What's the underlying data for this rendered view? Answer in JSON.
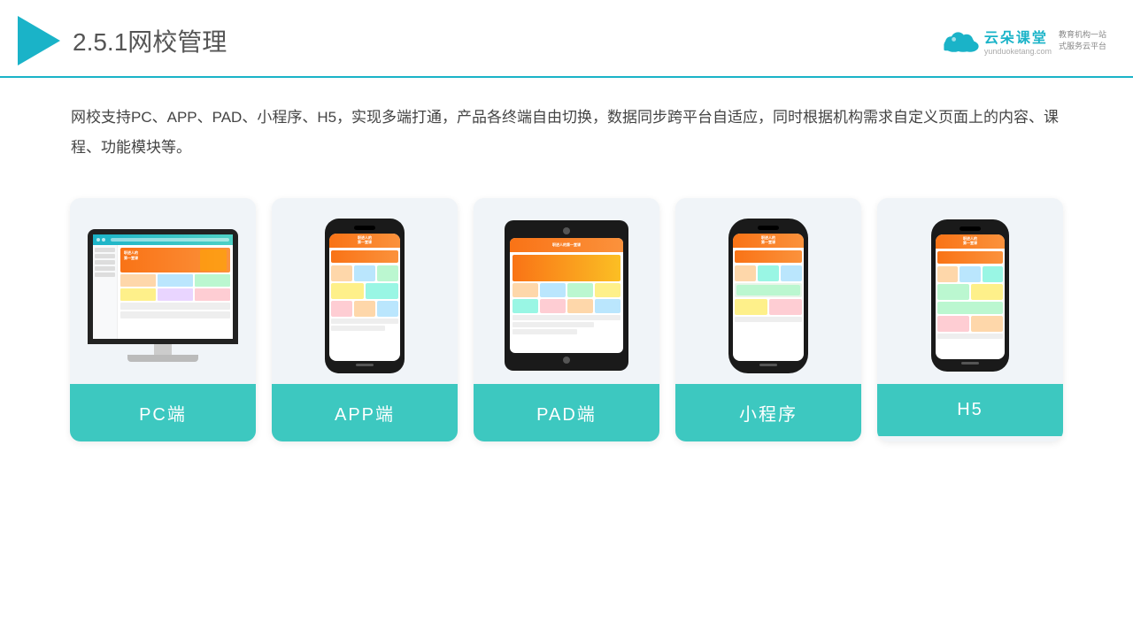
{
  "header": {
    "title_number": "2.5.1",
    "title_text": "网校管理",
    "brand_name": "云朵课堂",
    "brand_url": "yunduoketang.com",
    "brand_tagline_line1": "教育机构一站",
    "brand_tagline_line2": "式服务云平台"
  },
  "description": {
    "text": "网校支持PC、APP、PAD、小程序、H5，实现多端打通，产品各终端自由切换，数据同步跨平台自适应，同时根据机构需求自定义页面上的内容、课程、功能模块等。"
  },
  "cards": [
    {
      "id": "pc",
      "label": "PC端"
    },
    {
      "id": "app",
      "label": "APP端"
    },
    {
      "id": "pad",
      "label": "PAD端"
    },
    {
      "id": "miniapp",
      "label": "小程序"
    },
    {
      "id": "h5",
      "label": "H5"
    }
  ],
  "colors": {
    "accent": "#1ab3c8",
    "card_bg": "#f0f4f8",
    "card_label_bg": "#3dc8c0"
  }
}
